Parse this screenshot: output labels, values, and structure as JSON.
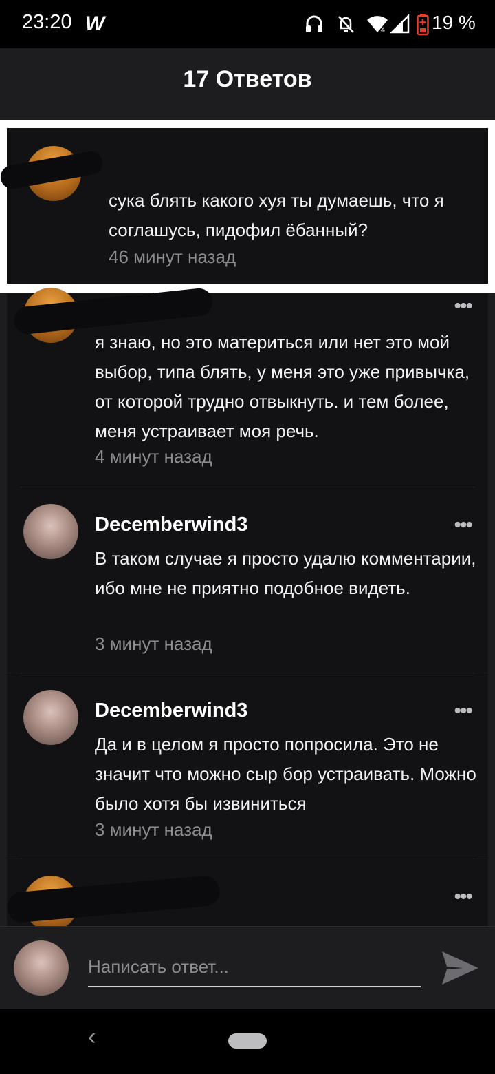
{
  "status_bar": {
    "time": "23:20",
    "app_icon": "wattpad-icon",
    "icons": [
      "headphones-icon",
      "bell-off-icon",
      "wifi-icon",
      "signal-icon",
      "battery-icon"
    ],
    "battery": "19 %",
    "battery_color": "#e0402f"
  },
  "header": {
    "title": "17 Ответов"
  },
  "parent_comment": {
    "text": "сука блять какого хуя ты думаешь, что я соглашусь, пидофил ёбанный?",
    "time": "46 минут назад"
  },
  "replies": [
    {
      "author": "",
      "text": "я знаю, но это материться или нет это мой выбор, типа блять, у меня это уже привычка, от которой трудно отвыкнуть. и тем более, меня устраивает моя речь.",
      "time": "4 минут назад",
      "more": "•••"
    },
    {
      "author": "Decemberwind3",
      "text": "В таком случае я просто удалю комментарии, ибо мне не приятно подобное видеть.",
      "time": "3 минут назад",
      "more": "•••"
    },
    {
      "author": "Decemberwind3",
      "text": "Да и в целом я просто попросила. Это не значит что можно сыр бор устраивать. Можно было хотя бы извиниться",
      "time": "3 минут назад",
      "more": "•••"
    },
    {
      "author": "",
      "text": "",
      "time": "",
      "more": "•••"
    }
  ],
  "reply_bar": {
    "placeholder": "Написать ответ..."
  },
  "nav": {
    "back": "‹"
  },
  "colors": {
    "background": "#1d1c1f",
    "card": "#121114",
    "muted_text": "#8c8b90"
  }
}
